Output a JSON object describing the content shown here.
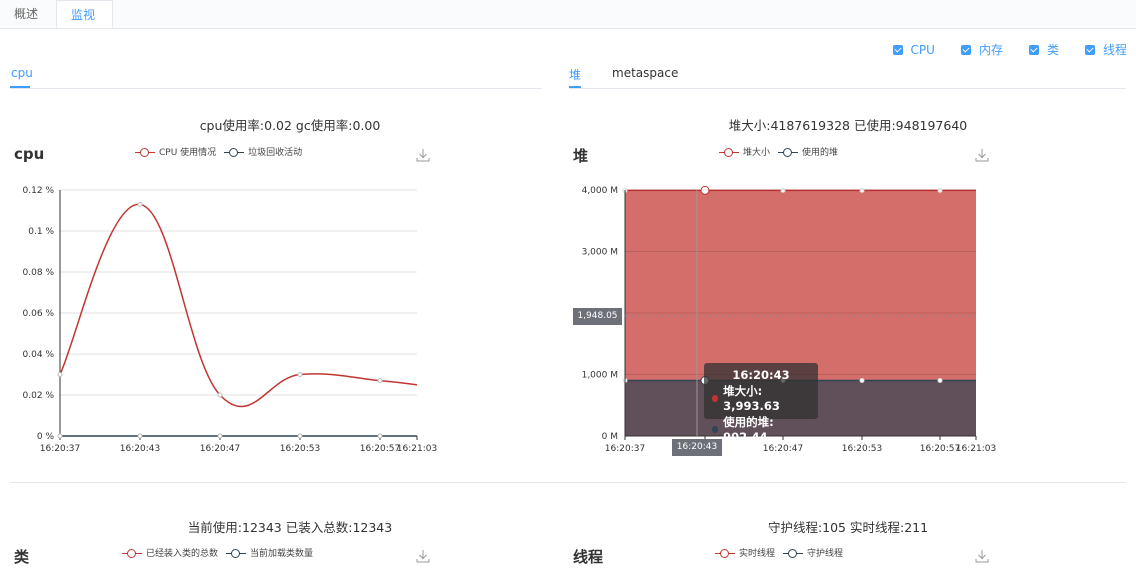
{
  "tabs": [
    {
      "label": "概述",
      "active": false
    },
    {
      "label": "监视",
      "active": true
    }
  ],
  "checkboxes": [
    {
      "label": "CPU",
      "checked": true
    },
    {
      "label": "内存",
      "checked": true
    },
    {
      "label": "类",
      "checked": true
    },
    {
      "label": "线程",
      "checked": true
    }
  ],
  "colors": {
    "accent": "#409eff",
    "red": "#c23531",
    "dark": "#2f4554",
    "heap_fill": "#d36e6b",
    "used_fill": "#614f59"
  },
  "left_panel": {
    "subtabs": [
      "cpu"
    ]
  },
  "right_panel": {
    "subtabs": [
      "堆",
      "metaspace"
    ]
  },
  "cpu": {
    "summary": "cpu使用率:0.02 gc使用率:0.00",
    "title": "cpu",
    "legend": [
      "CPU 使用情况",
      "垃圾回收活动"
    ]
  },
  "heap": {
    "summary": "堆大小:4187619328 已使用:948197640",
    "title": "堆",
    "legend": [
      "堆大小",
      "使用的堆"
    ],
    "axis_pointer_y": "1,948.05",
    "axis_pointer_x": "16:20:43",
    "tooltip": {
      "time": "16:20:43",
      "rows": [
        "堆大小: 3,993.63",
        "使用的堆: 902.44"
      ]
    }
  },
  "classes": {
    "summary": "当前使用:12343 已装入总数:12343",
    "title": "类",
    "legend": [
      "已经装入类的总数",
      "当前加载类数量"
    ]
  },
  "threads": {
    "summary": "守护线程:105 实时线程:211",
    "title": "线程",
    "legend": [
      "实时线程",
      "守护线程"
    ]
  },
  "chart_data": [
    {
      "type": "line",
      "title": "cpu",
      "x": [
        "16:20:37",
        "16:20:43",
        "16:20:47",
        "16:20:53",
        "16:20:57",
        "16:21:03"
      ],
      "y_ticks": [
        "0 %",
        "0.02 %",
        "0.04 %",
        "0.06 %",
        "0.08 %",
        "0.1 %",
        "0.12 %"
      ],
      "ylim": [
        0,
        0.12
      ],
      "series": [
        {
          "name": "CPU 使用情况",
          "values": [
            0.03,
            0.113,
            0.02,
            0.03,
            0.027,
            0.025
          ]
        },
        {
          "name": "垃圾回收活动",
          "values": [
            0,
            0,
            0,
            0,
            0,
            0
          ]
        }
      ]
    },
    {
      "type": "area",
      "title": "堆",
      "x": [
        "16:20:37",
        "16:20:43",
        "16:20:47",
        "16:20:53",
        "16:20:57",
        "16:21:03"
      ],
      "y_ticks": [
        "0 M",
        "1,000 M",
        "2,000 M",
        "3,000 M",
        "4,000 M"
      ],
      "ylim": [
        0,
        4000
      ],
      "series": [
        {
          "name": "堆大小",
          "values": [
            3993.63,
            3993.63,
            3993.63,
            3993.63,
            3993.63,
            3993.63
          ]
        },
        {
          "name": "使用的堆",
          "values": [
            902.44,
            902.44,
            902.44,
            902.44,
            902.44,
            902.44
          ]
        }
      ]
    }
  ]
}
